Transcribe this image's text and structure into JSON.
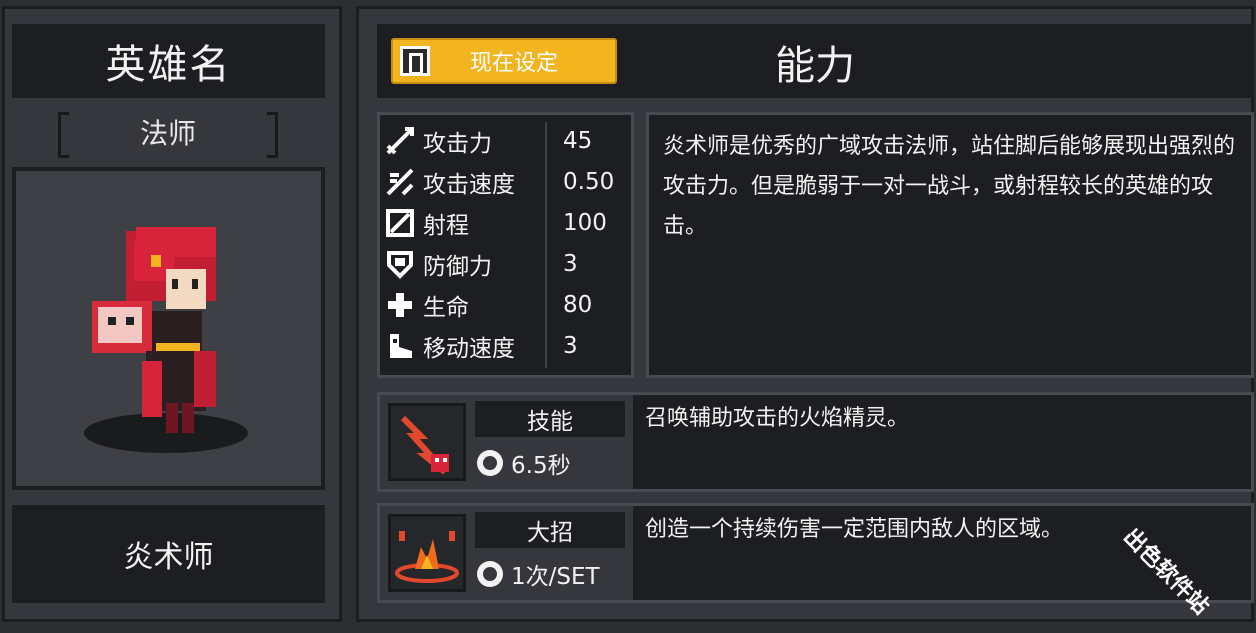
{
  "hero_panel": {
    "title": "英雄名",
    "class_label": "法师",
    "hero_name": "炎术师"
  },
  "header": {
    "set_now_label": "现在设定",
    "ability_title": "能力"
  },
  "stats": [
    {
      "label": "攻击力",
      "value": "45",
      "icon": "sword-icon"
    },
    {
      "label": "攻击速度",
      "value": "0.50",
      "icon": "attack-speed-icon"
    },
    {
      "label": "射程",
      "value": "100",
      "icon": "range-icon"
    },
    {
      "label": "防御力",
      "value": "3",
      "icon": "shield-icon"
    },
    {
      "label": "生命",
      "value": "80",
      "icon": "health-cross-icon"
    },
    {
      "label": "移动速度",
      "value": "3",
      "icon": "boot-icon"
    }
  ],
  "description": "炎术师是优秀的广域攻击法师，站住脚后能够展现出强烈的攻击力。但是脆弱于一对一战斗，或射程较长的英雄的攻击。",
  "skill": {
    "name": "技能",
    "cooldown": "6.5秒",
    "description": "召唤辅助攻击的火焰精灵。",
    "icon": "fire-spirit-icon"
  },
  "ultimate": {
    "name": "大招",
    "cooldown": "1次/SET",
    "description": "创造一个持续伤害一定范围内敌人的区域。",
    "icon": "fire-zone-icon"
  },
  "watermark": "出色软件站",
  "colors": {
    "accent_button": "#f2b51f",
    "panel_dark": "#1d1e21",
    "panel": "#35373c",
    "hero_hair": "#d8243a"
  }
}
